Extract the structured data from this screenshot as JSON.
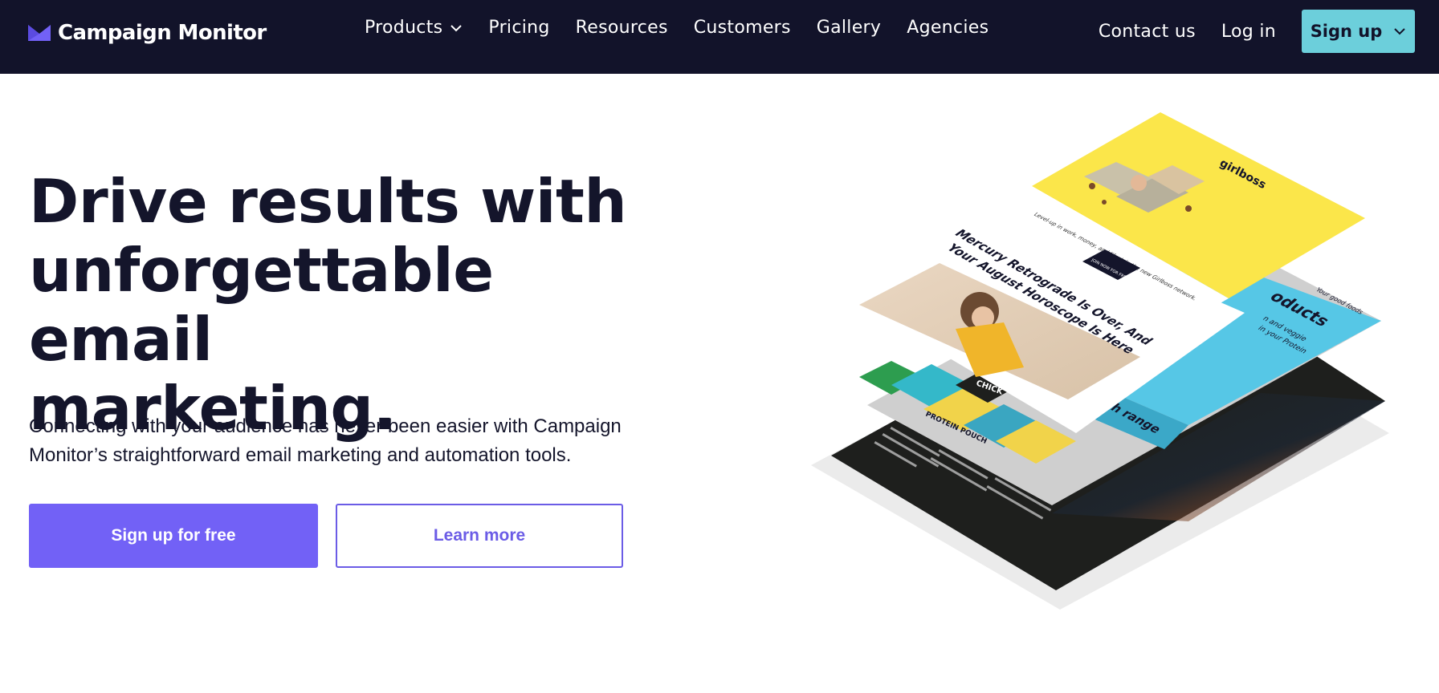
{
  "nav": {
    "logo_text": "Campaign Monitor",
    "links": [
      {
        "label": "Products",
        "has_dropdown": true
      },
      {
        "label": "Pricing"
      },
      {
        "label": "Resources"
      },
      {
        "label": "Customers"
      },
      {
        "label": "Gallery"
      },
      {
        "label": "Agencies"
      }
    ],
    "contact_label": "Contact us",
    "login_label": "Log in",
    "signup_label": "Sign up"
  },
  "hero": {
    "title_line1": "Drive results with",
    "title_line2": "unforgettable email",
    "title_line3": "marketing.",
    "subtitle_line1": "Connecting with your audience has never been easier with Campaign",
    "subtitle_line2": "Monitor’s straightforward email marketing and automation tools.",
    "primary_cta": "Sign up for free",
    "secondary_cta": "Learn more"
  },
  "illustration": {
    "girlboss_brand": "girlboss",
    "girlboss_tagline": "Level-up in work, money, and life. Join the new Girlboss network.",
    "girlboss_button": "JOIN NOW FOR FREE",
    "headline_line1": "Mercury Retrograde Is Over, And",
    "headline_line2": "Your August Horoscope Is Here",
    "products_word": "oducts",
    "products_sub1": "n and veggie",
    "products_sub2": "in your Protein",
    "range_word": "h range",
    "pouch_label": "PROTEIN POUCH",
    "chick_label": "CHICK",
    "small_caption": "Your good foods"
  },
  "colors": {
    "nav_bg": "#12132a",
    "accent": "#7261f6",
    "signup": "#6ccfdb",
    "yellow": "#fbe64a",
    "blue": "#56c7e6",
    "dark": "#1e1f1d"
  }
}
